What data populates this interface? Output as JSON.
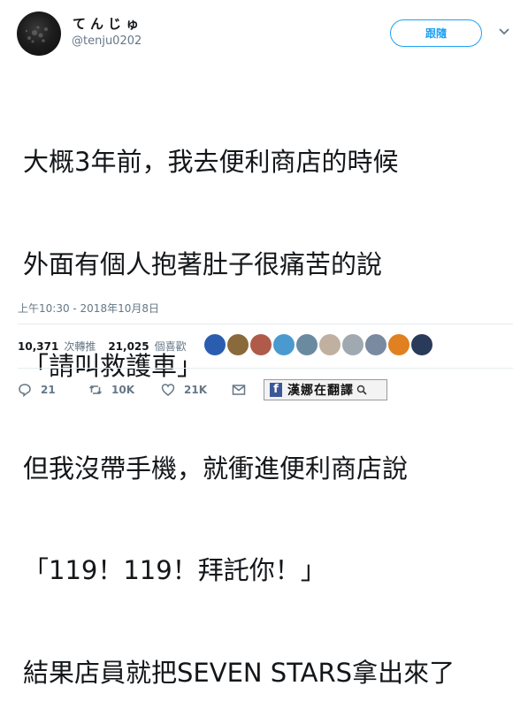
{
  "author": {
    "display_name": "てんじゅ",
    "handle": "@tenju0202"
  },
  "follow_button": {
    "label": "跟隨"
  },
  "menu": {
    "icon": "chevron-down-icon"
  },
  "tweet": {
    "lines": [
      "大概3年前，我去便利商店的時候",
      "外面有個人抱著肚子很痛苦的說",
      "「請叫救護車」",
      "但我沒帶手機，就衝進便利商店說",
      "「119！119！拜託你！」",
      "結果店員就把SEVEN STARS拿出來了"
    ],
    "timestamp": "上午10:30 - 2018年10月8日"
  },
  "stats": {
    "retweets": "10,371",
    "retweets_label": "次轉推",
    "likes": "21,025",
    "likes_label": "個喜歡"
  },
  "likers": [
    "#2a5db0",
    "#8a6a3a",
    "#b05a4a",
    "#4a9ad0",
    "#6a8aa0",
    "#c0b0a0",
    "#a0a8b0",
    "#7a8aa0",
    "#e08020",
    "#2a3a5a"
  ],
  "actions": {
    "replies": "21",
    "retweets": "10K",
    "likes": "21K"
  },
  "watermark": {
    "text": "漢娜在翻譯",
    "icon": "facebook-icon"
  },
  "colors": {
    "accent": "#1da1f2",
    "muted": "#657786",
    "text": "#14171a"
  }
}
